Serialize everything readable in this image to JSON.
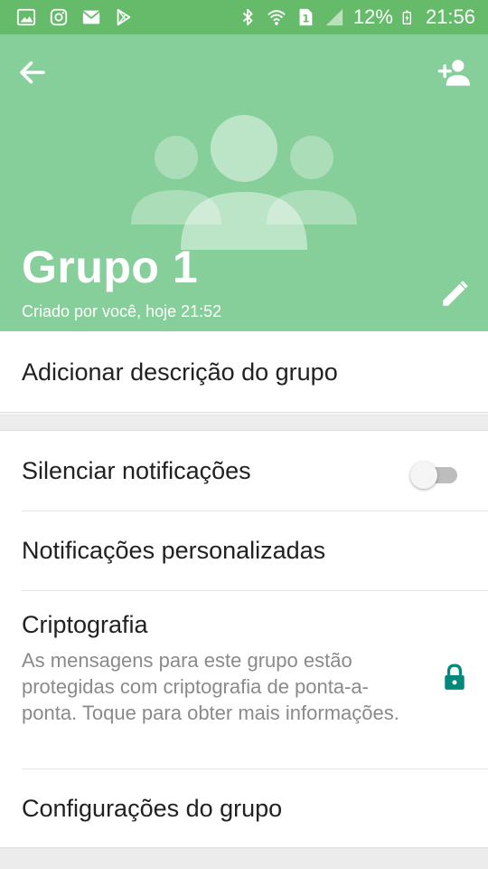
{
  "status_bar": {
    "battery": "12%",
    "time": "21:56",
    "sim_label": "1",
    "left_icons": [
      "gallery-icon",
      "instagram-icon",
      "mail-icon",
      "play-store-icon"
    ],
    "right_icons": [
      "bluetooth-icon",
      "wifi-icon",
      "sim-icon",
      "signal-icon",
      "battery-charging-icon"
    ]
  },
  "header": {
    "title": "Grupo 1",
    "subtitle": "Criado por você, hoje 21:52",
    "background_color": "#86cf9a"
  },
  "description": {
    "label": "Adicionar descrição do grupo"
  },
  "settings": {
    "mute": {
      "label": "Silenciar notificações",
      "enabled": false
    },
    "custom_notifications": {
      "label": "Notificações personalizadas"
    },
    "encryption": {
      "label": "Criptografia",
      "description": "As mensagens para este grupo estão protegidas com criptografia de ponta-a-ponta. Toque para obter mais informações.",
      "icon": "lock-icon",
      "icon_color": "#00897b"
    },
    "group_settings": {
      "label": "Configurações do grupo"
    }
  }
}
